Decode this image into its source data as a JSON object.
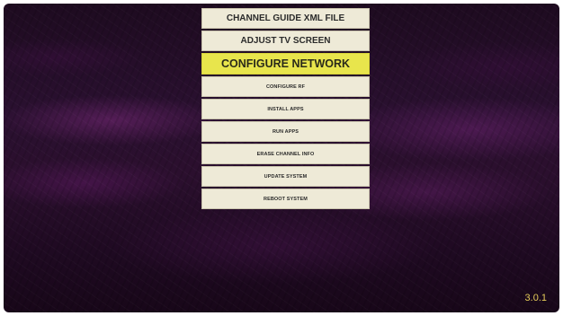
{
  "menu": {
    "items": [
      {
        "label": "CHANNEL GUIDE XML FILE"
      },
      {
        "label": "ADJUST TV SCREEN"
      },
      {
        "label": "CONFIGURE NETWORK"
      },
      {
        "label": "CONFIGURE RF"
      },
      {
        "label": "INSTALL APPS"
      },
      {
        "label": "RUN APPS"
      },
      {
        "label": "ERASE CHANNEL INFO"
      },
      {
        "label": "UPDATE SYSTEM"
      },
      {
        "label": "REBOOT SYSTEM"
      }
    ],
    "selected_index": 2
  },
  "version": "3.0.1",
  "colors": {
    "selected_background": "#e8e54c",
    "item_background": "#eeead7",
    "version_text": "#e6cc5a"
  }
}
